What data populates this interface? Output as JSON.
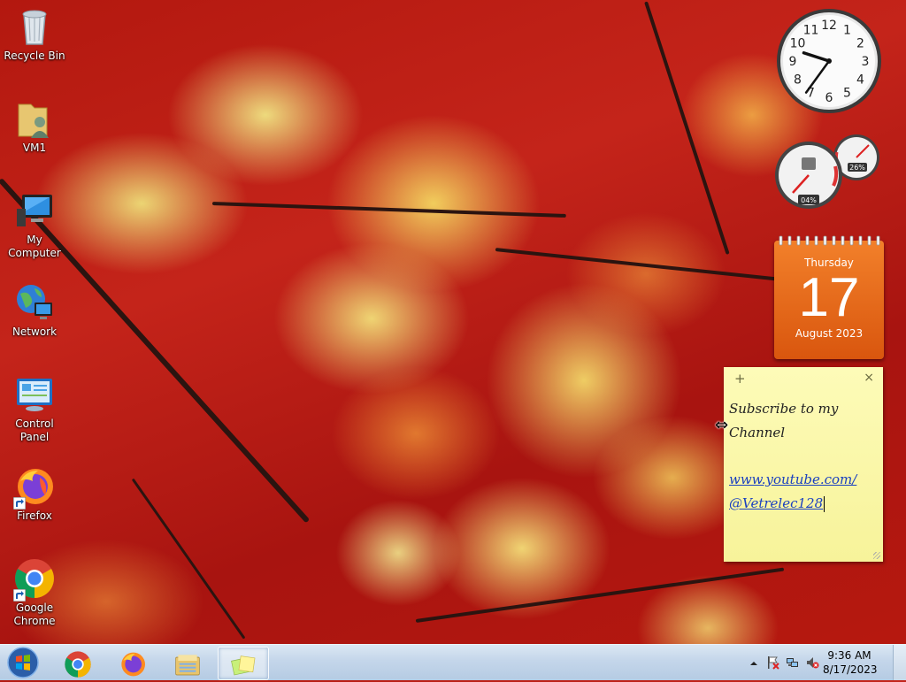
{
  "desktop": {
    "icons": [
      {
        "label": "Recycle Bin",
        "icon": "recycle-bin-icon"
      },
      {
        "label": "VM1",
        "icon": "user-folder-icon"
      },
      {
        "label": "My Computer",
        "icon": "computer-icon"
      },
      {
        "label": "Network",
        "icon": "network-icon"
      },
      {
        "label": "Control Panel",
        "icon": "control-panel-icon"
      },
      {
        "label": "Firefox",
        "icon": "firefox-icon"
      },
      {
        "label": "Google Chrome",
        "icon": "chrome-icon"
      }
    ]
  },
  "gadgets": {
    "clock": {
      "hour": 9,
      "minute": 36,
      "numerals": [
        "12",
        "1",
        "2",
        "3",
        "4",
        "5",
        "6",
        "7",
        "8",
        "9",
        "10",
        "11"
      ]
    },
    "cpu_meter": {
      "cpu": "04%",
      "memory": "26%"
    },
    "calendar": {
      "weekday": "Thursday",
      "day": "17",
      "month_year": "August 2023"
    },
    "sticky_note": {
      "line1": "Subscribe to my",
      "line2": "Channel",
      "link1": "www.youtube.com/",
      "link2": "@Vetrelec128",
      "add": "+",
      "close": "×"
    }
  },
  "taskbar": {
    "pinned": [
      "chrome-icon",
      "firefox-icon",
      "explorer-icon",
      "sticky-notes-icon"
    ],
    "active": "sticky-notes-icon",
    "clock": {
      "time": "9:36 AM",
      "date": "8/17/2023"
    },
    "tray_icons": [
      "show-hidden-icons-arrow",
      "action-center-flag-icon",
      "network-icon",
      "volume-muted-icon"
    ]
  },
  "colors": {
    "taskbar": "#c4d6ea",
    "calendar": "#e8691b",
    "note": "#fbf8a9",
    "link": "#1a40c0"
  }
}
